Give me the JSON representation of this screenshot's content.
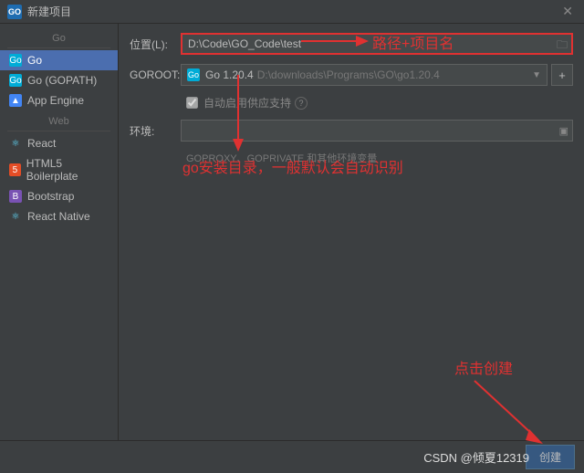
{
  "titlebar": {
    "icon_text": "GO",
    "title": "新建项目"
  },
  "sidebar": {
    "section_go": "Go",
    "section_web": "Web",
    "items": [
      {
        "label": "Go"
      },
      {
        "label": "Go (GOPATH)"
      },
      {
        "label": "App Engine"
      },
      {
        "label": "React"
      },
      {
        "label": "HTML5 Boilerplate"
      },
      {
        "label": "Bootstrap"
      },
      {
        "label": "React Native"
      }
    ]
  },
  "form": {
    "location_label": "位置(L):",
    "location_value": "D:\\Code\\GO_Code\\test",
    "goroot_label": "GOROOT:",
    "goroot_version": "Go 1.20.4",
    "goroot_path": "D:\\downloads\\Programs\\GO\\go1.20.4",
    "auto_supply": "自动启用供应支持",
    "env_label": "环境:",
    "env_hint": "GOPROXY、GOPRIVATE 和其他环境变量"
  },
  "footer": {
    "create_label": "创建"
  },
  "annotations": {
    "path_name": "路径+项目名",
    "goroot_hint": "go安装目录，一般默认会自动识别",
    "click_create": "点击创建"
  },
  "watermark": "CSDN @倾夏12319"
}
